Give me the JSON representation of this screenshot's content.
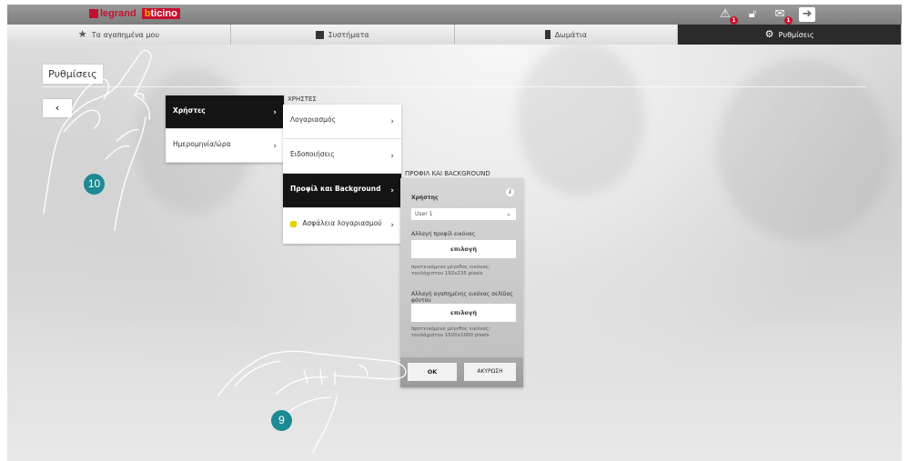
{
  "brand": {
    "legrand": "legrand",
    "bticino": "bticino"
  },
  "top_icons": [
    {
      "icon": "alarm-icon",
      "badge": "1"
    },
    {
      "icon": "lock-icon",
      "badge": ""
    },
    {
      "icon": "mail-icon",
      "badge": "1"
    },
    {
      "icon": "logout-icon",
      "badge": ""
    }
  ],
  "nav_tabs": [
    {
      "label": "Τα αγαπημένα μου",
      "icon": "star-icon",
      "active": false
    },
    {
      "label": "Συστήματα",
      "icon": "systems-icon",
      "active": false
    },
    {
      "label": "Δωμάτια",
      "icon": "door-icon",
      "active": false
    },
    {
      "label": "Ρυθμίσεις",
      "icon": "gear-icon",
      "active": true
    }
  ],
  "page_title": "Ρυθμίσεις",
  "back_label": "‹",
  "menu1": [
    {
      "label": "Χρήστες",
      "active": true
    },
    {
      "label": "Ημερομηνία/ώρα",
      "active": false
    }
  ],
  "menu2_header": "ΧΡΗΣΤΕΣ",
  "menu2": [
    {
      "label": "Λογαριασμός",
      "active": false
    },
    {
      "label": "Ειδοποιήσεις",
      "active": false
    },
    {
      "label": "Προφίλ και Background",
      "active": true
    },
    {
      "label": "Ασφάλεια λογαριασμού",
      "active": false
    }
  ],
  "panel": {
    "header": "ΠΡΟΦΙΛ ΚΑΙ BACKGROUND",
    "user_label": "Χρήστης",
    "user_value": "User 1",
    "profile_image_label": "Αλλαγή προφίλ εικόνας",
    "choose_label": "επιλογή",
    "profile_note": "προτεινόμενο μέγεθος εικόνας: τουλάχιστον 192x235 pixels",
    "background_label": "Αλλαγή αγαπημένης εικόνας σελίδας φόντου",
    "background_choose_label": "επιλογή",
    "background_note": "προτεινόμενο μέγεθος εικόνας: τουλάχιστον 1500x1000 pixels",
    "ok_label": "ΟΚ",
    "cancel_label": "ΑΚΥΡΩΣΗ"
  },
  "steps": {
    "step_a": "10",
    "step_b": "9"
  },
  "colors": {
    "step_teal": "#1b8a92",
    "brand_red": "#c8102e",
    "active_dark": "#141414"
  }
}
